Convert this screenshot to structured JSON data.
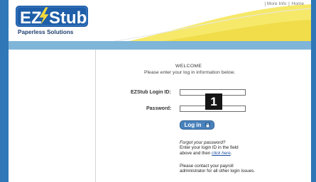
{
  "header": {
    "links": [
      "More Info",
      "Home"
    ],
    "separator": "|",
    "logo_text_ez": "EZ",
    "logo_text_stub": "Stub",
    "logo_tagline": "Paperless Solutions"
  },
  "login": {
    "welcome": "WELCOME",
    "instruction": "Please enter your log in information below.",
    "login_id_label": "EZStub Login ID:",
    "password_label": "Password:",
    "login_id_value": "",
    "password_value": "",
    "button_label": "Log in",
    "callout_number": "1",
    "forgot_title": "Forgot your password?",
    "forgot_line1": "Enter your login ID in the field",
    "forgot_line2_prefix": "above and then ",
    "forgot_link": "click here",
    "forgot_line2_suffix": ".",
    "contact_line1": "Please contact your payroll",
    "contact_line2": "administrator for all other login issues."
  },
  "colors": {
    "border_blue": "#2f77b6",
    "band_blue": "#7fb5d9",
    "swoosh_yellow": "#f6e96a",
    "logo_blue": "#1f5ea8",
    "logo_yellow": "#f4d93a",
    "button_blue": "#4a82bc"
  },
  "icons": [
    "lock-icon",
    "lightning-bolt-icon"
  ]
}
